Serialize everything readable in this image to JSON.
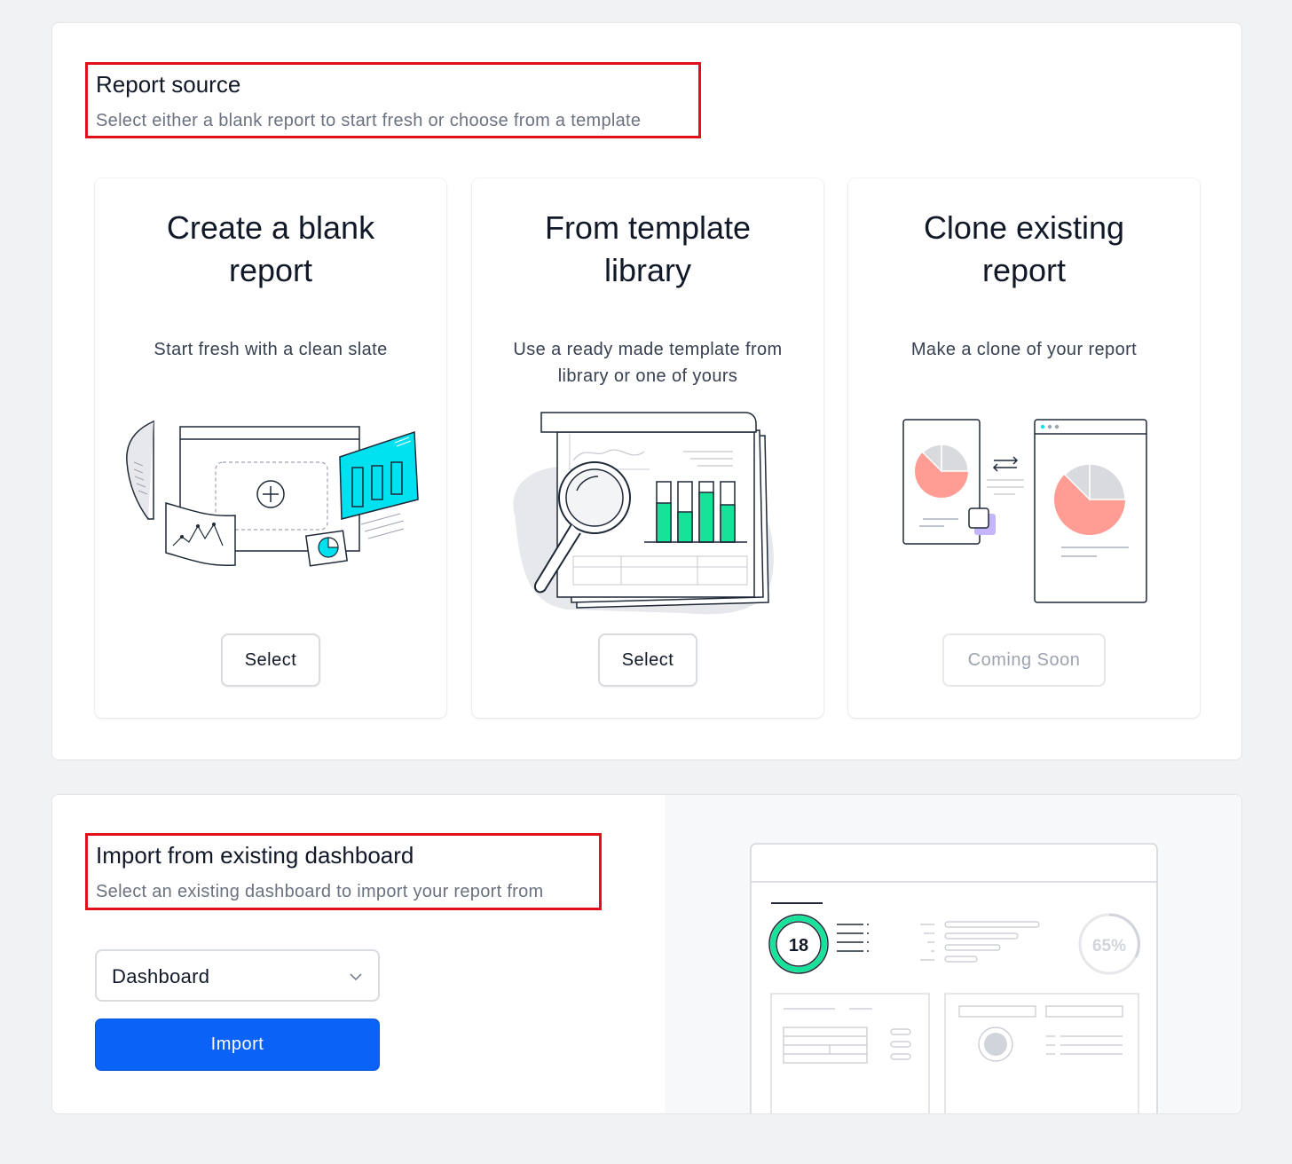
{
  "report_source": {
    "title": "Report source",
    "subtitle": "Select either a blank report to start fresh or choose from a template",
    "cards": [
      {
        "title": "Create a blank report",
        "description": "Start fresh with a clean slate",
        "button_label": "Select",
        "illustration": "blank-report-illustration"
      },
      {
        "title": "From template library",
        "description": "Use a ready made template from library or one of yours",
        "button_label": "Select",
        "illustration": "template-library-illustration"
      },
      {
        "title": "Clone existing report",
        "description": "Make a clone of your report",
        "button_label": "Coming Soon",
        "illustration": "clone-report-illustration"
      }
    ]
  },
  "import": {
    "title": "Import from existing dashboard",
    "subtitle": "Select an existing dashboard to import your report from",
    "select": {
      "value": "Dashboard"
    },
    "button_label": "Import",
    "preview": {
      "counter_value": "18",
      "percent_value": "65%"
    }
  },
  "colors": {
    "accent": "#0b62f6",
    "highlight": "#e0111b",
    "teal": "#00e1f0",
    "green": "#17e29a",
    "salmon": "#ff9c94"
  }
}
